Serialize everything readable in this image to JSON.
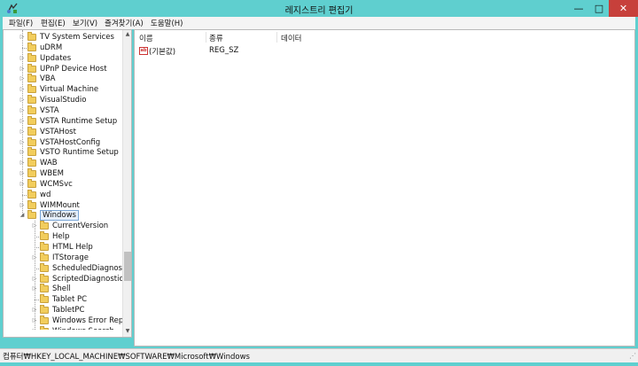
{
  "window": {
    "title": "레지스트리 편집기",
    "app_icon": "registry-editor-icon"
  },
  "window_controls": {
    "minimize": "—",
    "maximize": "□",
    "close": "✕"
  },
  "menu": [
    {
      "label": "파일(F)"
    },
    {
      "label": "편집(E)"
    },
    {
      "label": "보기(V)"
    },
    {
      "label": "즐겨찾기(A)"
    },
    {
      "label": "도움말(H)"
    }
  ],
  "tree": {
    "nodes": [
      {
        "label": "TV System Services",
        "level": 1,
        "expander": "▷"
      },
      {
        "label": "uDRM",
        "level": 1,
        "expander": ""
      },
      {
        "label": "Updates",
        "level": 1,
        "expander": "▷"
      },
      {
        "label": "UPnP Device Host",
        "level": 1,
        "expander": "▷"
      },
      {
        "label": "VBA",
        "level": 1,
        "expander": "▷"
      },
      {
        "label": "Virtual Machine",
        "level": 1,
        "expander": "▷"
      },
      {
        "label": "VisualStudio",
        "level": 1,
        "expander": "▷"
      },
      {
        "label": "VSTA",
        "level": 1,
        "expander": "▷"
      },
      {
        "label": "VSTA Runtime Setup",
        "level": 1,
        "expander": "▷"
      },
      {
        "label": "VSTAHost",
        "level": 1,
        "expander": "▷"
      },
      {
        "label": "VSTAHostConfig",
        "level": 1,
        "expander": "▷"
      },
      {
        "label": "VSTO Runtime Setup",
        "level": 1,
        "expander": "▷"
      },
      {
        "label": "WAB",
        "level": 1,
        "expander": "▷"
      },
      {
        "label": "WBEM",
        "level": 1,
        "expander": "▷"
      },
      {
        "label": "WCMSvc",
        "level": 1,
        "expander": "▷"
      },
      {
        "label": "wd",
        "level": 1,
        "expander": ""
      },
      {
        "label": "WIMMount",
        "level": 1,
        "expander": "▷"
      },
      {
        "label": "Windows",
        "level": 1,
        "expander": "◢",
        "selected": true
      },
      {
        "label": "CurrentVersion",
        "level": 2,
        "expander": "▷"
      },
      {
        "label": "Help",
        "level": 2,
        "expander": ""
      },
      {
        "label": "HTML Help",
        "level": 2,
        "expander": ""
      },
      {
        "label": "ITStorage",
        "level": 2,
        "expander": "▷"
      },
      {
        "label": "ScheduledDiagnostics",
        "level": 2,
        "expander": ""
      },
      {
        "label": "ScriptedDiagnosticsPr",
        "level": 2,
        "expander": "▷"
      },
      {
        "label": "Shell",
        "level": 2,
        "expander": "▷"
      },
      {
        "label": "Tablet PC",
        "level": 2,
        "expander": ""
      },
      {
        "label": "TabletPC",
        "level": 2,
        "expander": "▷"
      },
      {
        "label": "Windows Error Report",
        "level": 2,
        "expander": "▷"
      },
      {
        "label": "Windows Search",
        "level": 2,
        "expander": "▷"
      }
    ],
    "scrollbar": {
      "up": "▲",
      "down": "▼"
    }
  },
  "values_list": {
    "columns": [
      "이름",
      "종류",
      "데이터"
    ],
    "rows": [
      {
        "name": "(기본값)",
        "type": "REG_SZ",
        "data": "",
        "icon": "ab"
      }
    ]
  },
  "status": {
    "path": "컴퓨터₩HKEY_LOCAL_MACHINE₩SOFTWARE₩Microsoft₩Windows"
  }
}
